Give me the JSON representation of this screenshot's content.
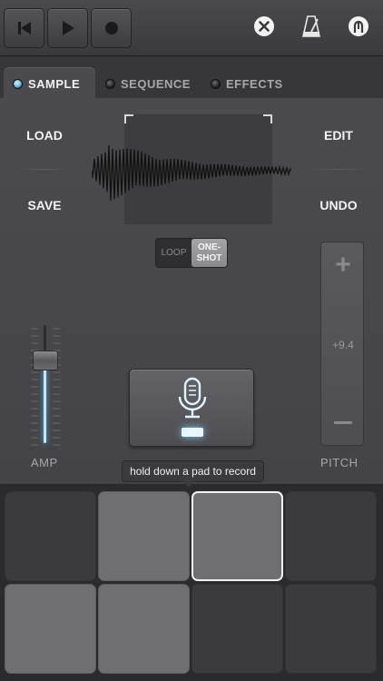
{
  "toolbar": {
    "buttons": [
      {
        "name": "skip-back-icon"
      },
      {
        "name": "play-icon"
      },
      {
        "name": "record-icon"
      }
    ],
    "right_icons": [
      {
        "name": "close-icon"
      },
      {
        "name": "metronome-icon"
      },
      {
        "name": "power-icon"
      }
    ]
  },
  "tabs": [
    {
      "label": "SAMPLE",
      "active": true
    },
    {
      "label": "SEQUENCE",
      "active": false
    },
    {
      "label": "EFFECTS",
      "active": false
    }
  ],
  "sample": {
    "load_label": "LOAD",
    "save_label": "SAVE",
    "edit_label": "EDIT",
    "undo_label": "UNDO",
    "mode": {
      "loop_label": "LOOP",
      "oneshot_line1": "ONE-",
      "oneshot_line2": "SHOT",
      "selected": "one-shot"
    },
    "pitch": {
      "plus": "+",
      "value": "+9.4",
      "label": "PITCH"
    },
    "amp": {
      "label": "AMP",
      "level": 0.75
    }
  },
  "tooltip": "hold down a pad to record",
  "pads": [
    {
      "state": "dark"
    },
    {
      "state": "light"
    },
    {
      "state": "selected"
    },
    {
      "state": "dark"
    },
    {
      "state": "light"
    },
    {
      "state": "light"
    },
    {
      "state": "dark"
    },
    {
      "state": "dark"
    }
  ],
  "colors": {
    "accent": "#6ab6dc",
    "background": "#2a2a2c",
    "panel": "#4b4b4f"
  }
}
